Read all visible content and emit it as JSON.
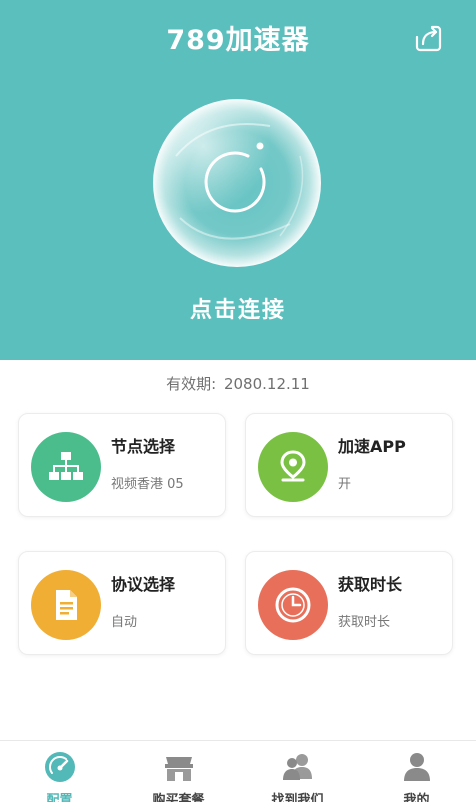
{
  "header": {
    "title": "789加速器",
    "connect_label": "点击连接",
    "share_icon": "share-export-icon",
    "bg_color": "#5bbfbe"
  },
  "expiry": {
    "label": "有效期:",
    "value": "2080.12.11"
  },
  "cards": {
    "node": {
      "title": "节点选择",
      "subtitle": "视频香港 05",
      "icon": "network-tree-icon",
      "color": "#4bbd8d"
    },
    "app": {
      "title": "加速APP",
      "subtitle": "开",
      "icon": "location-pin-icon",
      "color": "#7ac143"
    },
    "protocol": {
      "title": "协议选择",
      "subtitle": "自动",
      "icon": "document-icon",
      "color": "#f0ae35"
    },
    "time": {
      "title": "获取时长",
      "subtitle": "获取时长",
      "icon": "clock-icon",
      "color": "#e8705a"
    }
  },
  "tabbar": {
    "active_color": "#52b9b8",
    "items": [
      {
        "label": "配置",
        "icon": "gauge-icon",
        "active": true
      },
      {
        "label": "购买套餐",
        "icon": "store-icon",
        "active": false
      },
      {
        "label": "找到我们",
        "icon": "people-icon",
        "active": false
      },
      {
        "label": "我的",
        "icon": "user-icon",
        "active": false
      }
    ]
  }
}
